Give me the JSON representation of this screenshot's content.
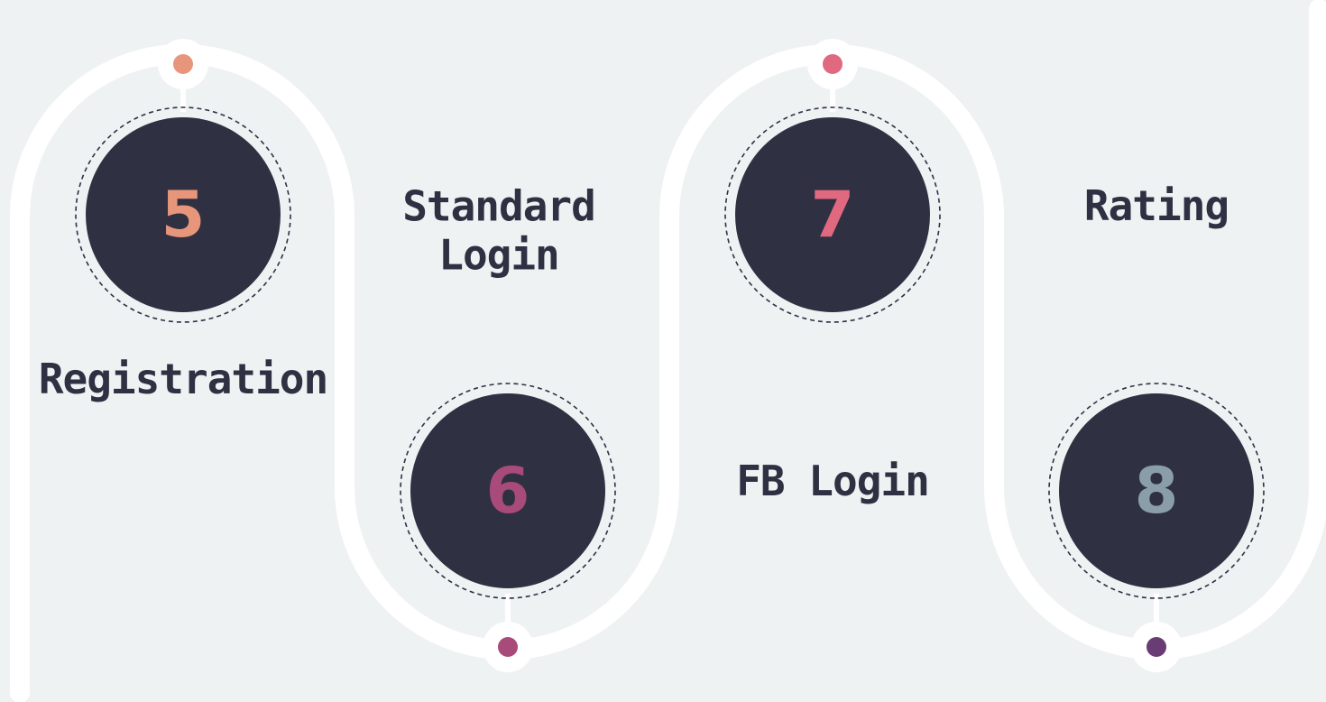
{
  "steps": [
    {
      "number": "5",
      "label": "Registration",
      "number_color": "#e8967b",
      "dot_color": "#e8967b"
    },
    {
      "number": "6",
      "label": "Standard Login",
      "number_color": "#a84a7a",
      "dot_color": "#a84a7a"
    },
    {
      "number": "7",
      "label": "FB Login",
      "number_color": "#e0697f",
      "dot_color": "#e0697f"
    },
    {
      "number": "8",
      "label": "Rating",
      "number_color": "#8a9ea9",
      "dot_color": "#6a3c74"
    }
  ],
  "colors": {
    "background": "#eff2f3",
    "path": "#ffffff",
    "circle_fill": "#2f3143",
    "label_text": "#2f3143"
  }
}
